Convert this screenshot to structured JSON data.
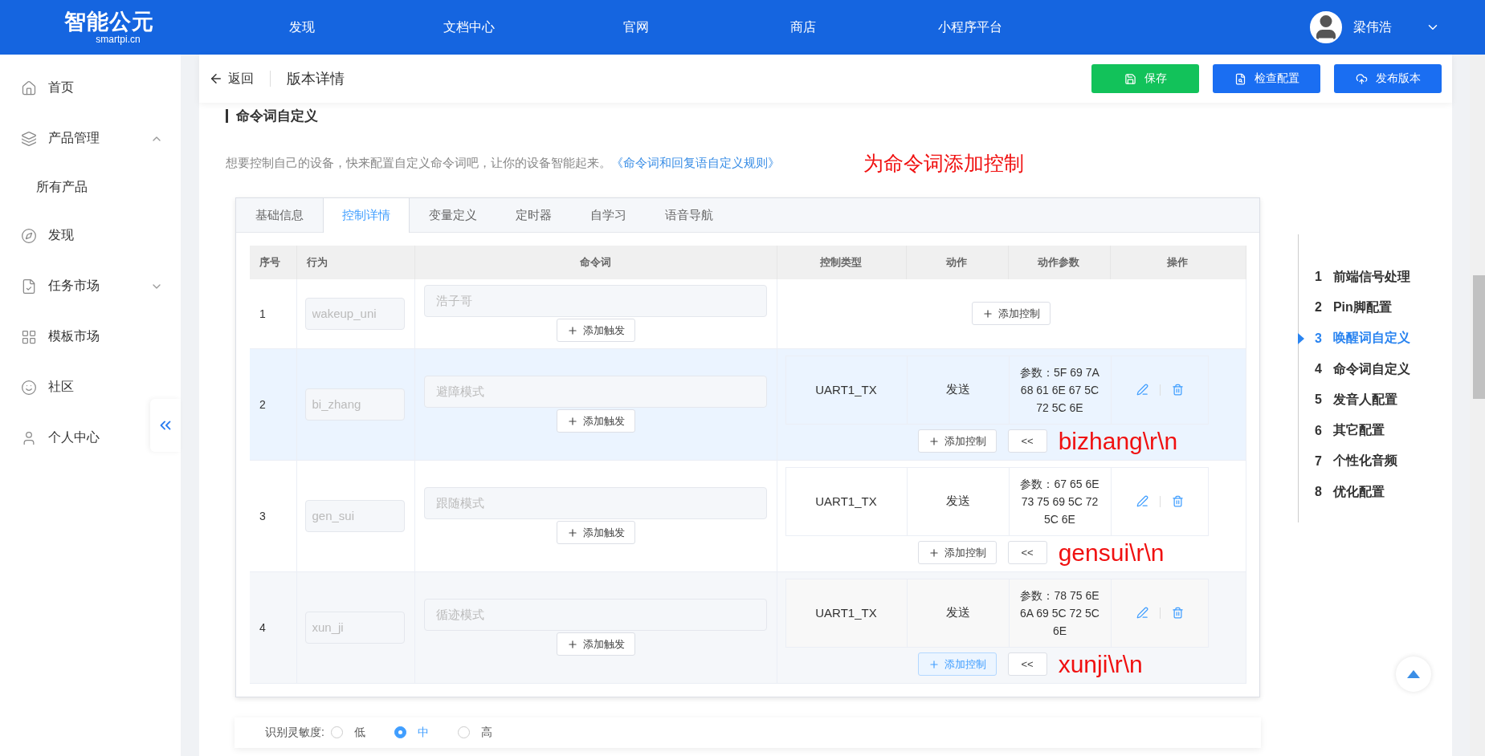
{
  "header": {
    "logo": {
      "name": "智能公元",
      "subtitle": "smartpi.cn"
    },
    "nav": [
      "发现",
      "文档中心",
      "官网",
      "商店",
      "小程序平台"
    ],
    "user": {
      "name": "梁伟浩"
    }
  },
  "sidebar": {
    "items": [
      {
        "label": "首页"
      },
      {
        "label": "产品管理",
        "expanded": true,
        "children": [
          {
            "label": "所有产品"
          }
        ]
      },
      {
        "label": "发现"
      },
      {
        "label": "任务市场",
        "expanded": false
      },
      {
        "label": "模板市场"
      },
      {
        "label": "社区"
      },
      {
        "label": "个人中心"
      }
    ]
  },
  "toolbar": {
    "back": "返回",
    "title": "版本详情",
    "buttons": [
      {
        "label": "保存",
        "kind": "success"
      },
      {
        "label": "检查配置",
        "kind": "check"
      },
      {
        "label": "发布版本",
        "kind": "publish"
      }
    ]
  },
  "section": {
    "title": "命令词自定义",
    "description": "想要控制自己的设备，快来配置自定义命令词吧，让你的设备智能起来。",
    "link": "《命令词和回复语自定义规则》",
    "annotation": "为命令词添加控制"
  },
  "tabs": [
    {
      "label": "基础信息",
      "selected": false
    },
    {
      "label": "控制详情",
      "selected": true
    },
    {
      "label": "变量定义",
      "selected": false
    },
    {
      "label": "定时器",
      "selected": false
    },
    {
      "label": "自学习",
      "selected": false
    },
    {
      "label": "语音导航",
      "selected": false
    }
  ],
  "table": {
    "columns": [
      "序号",
      "行为",
      "命令词",
      "控制类型",
      "动作",
      "动作参数",
      "操作"
    ],
    "rows": [
      {
        "index": "1",
        "behavior": "wakeup_uni",
        "command": "浩子哥",
        "trigger_button": "添加触发",
        "hovered": false,
        "controls": [],
        "empty_controls_button": {
          "label": "添加控制",
          "focused": false
        }
      },
      {
        "index": "2",
        "behavior": "bi_zhang",
        "command": "避障模式",
        "trigger_button": "添加触发",
        "hovered": true,
        "controls": [
          {
            "type": "UART1_TX",
            "action": "发送",
            "params": "参数：5F 69 7A 68 61 6E 67 5C 72 5C 6E"
          }
        ],
        "add_control": {
          "label": "添加控制",
          "focused": false
        },
        "collapse": "<<",
        "annotation": "bizhang\\r\\n"
      },
      {
        "index": "3",
        "behavior": "gen_sui",
        "command": "跟随模式",
        "trigger_button": "添加触发",
        "hovered": false,
        "controls": [
          {
            "type": "UART1_TX",
            "action": "发送",
            "params": "参数：67 65 6E 73 75 69 5C 72 5C 6E"
          }
        ],
        "add_control": {
          "label": "添加控制",
          "focused": false
        },
        "collapse": "<<",
        "annotation": "gensui\\r\\n"
      },
      {
        "index": "4",
        "behavior": "xun_ji",
        "command": "循迹模式",
        "trigger_button": "添加触发",
        "hovered": false,
        "controls": [
          {
            "type": "UART1_TX",
            "action": "发送",
            "params": "参数：78 75 6E 6A 69 5C 72 5C 6E"
          }
        ],
        "add_control": {
          "label": "添加控制",
          "focused": true
        },
        "collapse": "<<",
        "annotation": "xunji\\r\\n"
      }
    ]
  },
  "sensitivity": {
    "label": "识别灵敏度:",
    "options": [
      {
        "label": "低",
        "selected": false
      },
      {
        "label": "中",
        "selected": true
      },
      {
        "label": "高",
        "selected": false
      }
    ]
  },
  "right_nav": [
    {
      "number": "1",
      "label": "前端信号处理",
      "selected": false
    },
    {
      "number": "2",
      "label": "Pin脚配置",
      "selected": false
    },
    {
      "number": "3",
      "label": "唤醒词自定义",
      "selected": true
    },
    {
      "number": "4",
      "label": "命令词自定义",
      "selected": false
    },
    {
      "number": "5",
      "label": "发音人配置",
      "selected": false
    },
    {
      "number": "6",
      "label": "其它配置",
      "selected": false
    },
    {
      "number": "7",
      "label": "个性化音频",
      "selected": false
    },
    {
      "number": "8",
      "label": "优化配置",
      "selected": false
    }
  ]
}
